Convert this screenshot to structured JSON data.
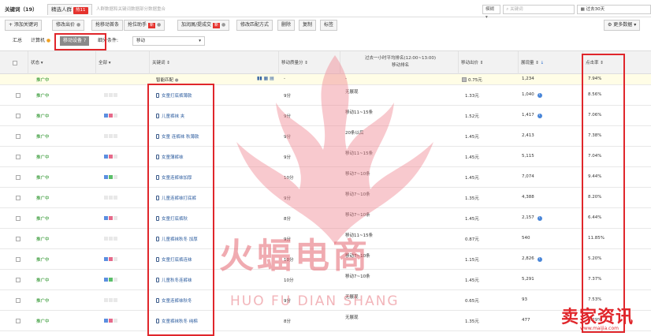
{
  "tabs": {
    "keywords_label": "关键词",
    "keywords_count": "（19）",
    "crowd_label": "精选人群",
    "crowd_badge": "热11",
    "desc": "人群数据和关键词数据部分数据重合"
  },
  "search": {
    "select_label": "模糊",
    "placeholder": "关键词",
    "date_label": "过去30天"
  },
  "toolbar": {
    "add": "+ 添加关键词",
    "modify_bid": "修改出价",
    "grab": "抢移动首条",
    "rank": "抢位助手",
    "rank_badge": "新",
    "boost": "加润屑/提成交",
    "boost_badge": "新",
    "match": "修改匹配方式",
    "delete": "删除",
    "copy": "复制",
    "tag": "标签",
    "more": "更多数据"
  },
  "subbar": {
    "summary": "汇总",
    "computer": "计算机",
    "mobile": "移动设备",
    "split_label": "细分条件:",
    "split_value": "移动"
  },
  "columns": {
    "status": "状态",
    "all": "全部",
    "keyword": "关键词",
    "quality": "移动质量分",
    "rank_header": "过去一小时平均排名(12:00~13:00)",
    "rank_sub": "移动排名",
    "bid": "移动出价",
    "impressions": "展现量",
    "ctr": "点击率"
  },
  "smart": {
    "status": "推广中",
    "keyword": "智能匹配",
    "quality": "-",
    "rank": "-",
    "bid": "0.75元",
    "impressions": "1,234",
    "ctr": "7.94%"
  },
  "rows": [
    {
      "status": "推广中",
      "keyword": "女童打底裤薄款",
      "quality": "9分",
      "rank": "无展现",
      "bid": "1.33元",
      "impressions": "1,040",
      "info": true,
      "ctr": "8.56%"
    },
    {
      "status": "推广中",
      "keyword": "儿童裤袜 夹",
      "quality": "9分",
      "rank": "移动11~15条",
      "bid": "1.52元",
      "impressions": "1,417",
      "info": true,
      "ctr": "7.06%"
    },
    {
      "status": "推广中",
      "keyword": "女童 连裤袜 秋薄款",
      "quality": "9分",
      "rank": "20条以后",
      "bid": "1.45元",
      "impressions": "2,413",
      "info": false,
      "ctr": "7.38%"
    },
    {
      "status": "推广中",
      "keyword": "女童薄裤袜",
      "quality": "9分",
      "rank": "移动11~15条",
      "bid": "1.45元",
      "impressions": "5,115",
      "info": false,
      "ctr": "7.04%"
    },
    {
      "status": "推广中",
      "keyword": "女童连裤袜加厚",
      "quality": "10分",
      "rank": "移动7~10条",
      "bid": "1.45元",
      "impressions": "7,074",
      "info": false,
      "ctr": "9.44%"
    },
    {
      "status": "推广中",
      "keyword": "儿童连裤袜打底裤",
      "quality": "9分",
      "rank": "移动7~10条",
      "bid": "1.35元",
      "impressions": "4,388",
      "info": false,
      "ctr": "8.20%"
    },
    {
      "status": "推广中",
      "keyword": "女童打底裤秋",
      "quality": "8分",
      "rank": "移动7~10条",
      "bid": "1.45元",
      "impressions": "2,157",
      "info": true,
      "ctr": "6.44%"
    },
    {
      "status": "推广中",
      "keyword": "儿童裤袜秋冬 加厚",
      "quality": "9分",
      "rank": "移动11~15条",
      "bid": "0.87元",
      "impressions": "540",
      "info": false,
      "ctr": "11.85%"
    },
    {
      "status": "推广中",
      "keyword": "女童打底裤连袜",
      "quality": "10分",
      "rank": "移动7~10条",
      "bid": "1.15元",
      "impressions": "2,826",
      "info": true,
      "ctr": "5.20%"
    },
    {
      "status": "推广中",
      "keyword": "儿童秋冬连裤袜",
      "quality": "10分",
      "rank": "移动7~10条",
      "bid": "1.45元",
      "impressions": "5,291",
      "info": false,
      "ctr": "7.37%"
    },
    {
      "status": "推广中",
      "keyword": "女童连裤袜秋冬",
      "quality": "9分",
      "rank": "无展现",
      "bid": "0.65元",
      "impressions": "93",
      "info": false,
      "ctr": "7.53%"
    },
    {
      "status": "推广中",
      "keyword": "女童裤袜秋冬 纯棉",
      "quality": "8分",
      "rank": "无展现",
      "bid": "1.35元",
      "impressions": "477",
      "info": false,
      "ctr": "6.29%"
    }
  ],
  "watermark": {
    "brand": "火蝠电商",
    "brand_sub": "HUO FU DIAN SHANG",
    "site": "卖家资讯",
    "site_url": "www.maijia.com"
  },
  "colors": {
    "accent_red": "#e0262b",
    "status_green": "#1a8c1a",
    "link_blue": "#2d5d9f"
  }
}
